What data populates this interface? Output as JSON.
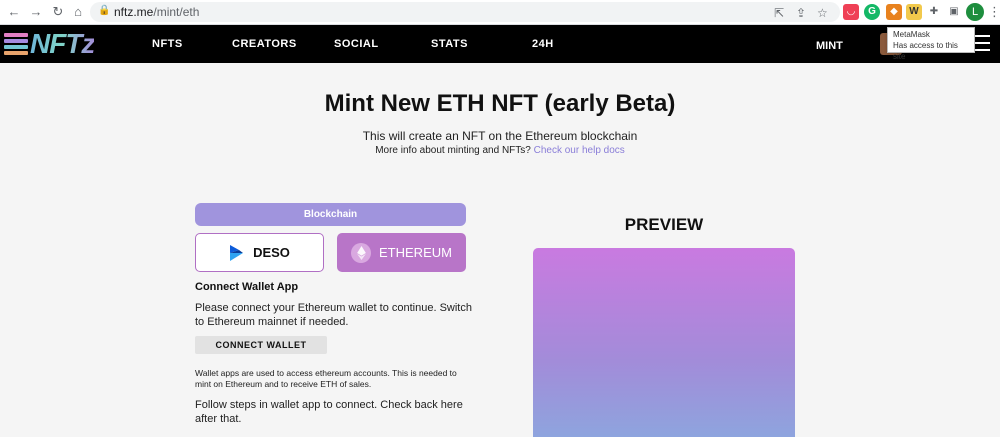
{
  "browser": {
    "url_host": "nftz.me",
    "url_path": "/mint/eth",
    "tooltip_title": "MetaMask",
    "tooltip_body": "Has access to this site",
    "profile_initial": "L"
  },
  "header": {
    "logo_text": "NFTz",
    "nav": [
      "NFTS",
      "CREATORS",
      "SOCIAL",
      "STATS",
      "24H"
    ],
    "mint_label": "MINT"
  },
  "main": {
    "title": "Mint New ETH NFT (early Beta)",
    "subtitle": "This will create an NFT on the Ethereum blockchain",
    "info_text": "More info about minting and NFTs?",
    "info_link": "Check our help docs"
  },
  "form": {
    "blockchain_label": "Blockchain",
    "deso_label": "DESO",
    "eth_label": "ETHEREUM",
    "connect_title": "Connect Wallet App",
    "connect_desc": "Please connect your Ethereum wallet to continue. Switch to Ethereum mainnet if needed.",
    "connect_button": "CONNECT WALLET",
    "wallet_note": "Wallet apps are used to access ethereum accounts. This is needed to mint on Ethereum and to receive ETH of sales.",
    "follow_steps": "Follow steps in wallet app to connect. Check back here after that."
  },
  "preview": {
    "title": "PREVIEW"
  },
  "colors": {
    "accent": "#a094dd",
    "eth_selected": "#b875c8",
    "link": "#8a7ed8"
  }
}
